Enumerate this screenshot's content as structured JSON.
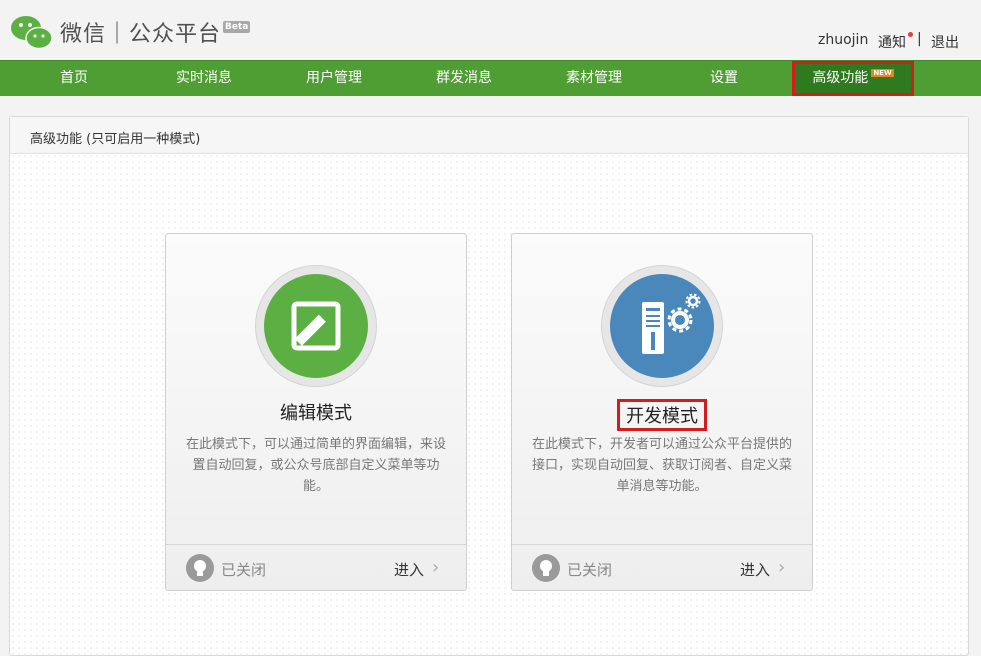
{
  "header": {
    "logo_text": "微信｜公众平台",
    "beta_badge": "Beta",
    "username": "zhuojin",
    "notice_label": "通知",
    "separator": "|",
    "logout_label": "退出"
  },
  "nav": {
    "items": [
      {
        "label": "首页"
      },
      {
        "label": "实时消息"
      },
      {
        "label": "用户管理"
      },
      {
        "label": "群发消息"
      },
      {
        "label": "素材管理"
      },
      {
        "label": "设置"
      },
      {
        "label": "高级功能"
      }
    ],
    "new_badge": "NEW",
    "active_index": 6
  },
  "panel": {
    "title": "高级功能 (只可启用一种模式)"
  },
  "cards": [
    {
      "title": "编辑模式",
      "description": "在此模式下，可以通过简单的界面编辑，来设置自动回复，或公众号底部自定义菜单等功能。",
      "status": "已关闭",
      "enter_label": "进入",
      "icon": "edit-icon",
      "color": "#5cb043"
    },
    {
      "title": "开发模式",
      "description": "在此模式下，开发者可以通过公众平台提供的接口，实现自动回复、获取订阅者、自定义菜单消息等功能。",
      "status": "已关闭",
      "enter_label": "进入",
      "icon": "server-gear-icon",
      "color": "#4a88bb"
    }
  ],
  "colors": {
    "nav_bg": "#4f9e34",
    "nav_active_bg": "#2f7a1f",
    "highlight_border": "#d31d1d"
  }
}
